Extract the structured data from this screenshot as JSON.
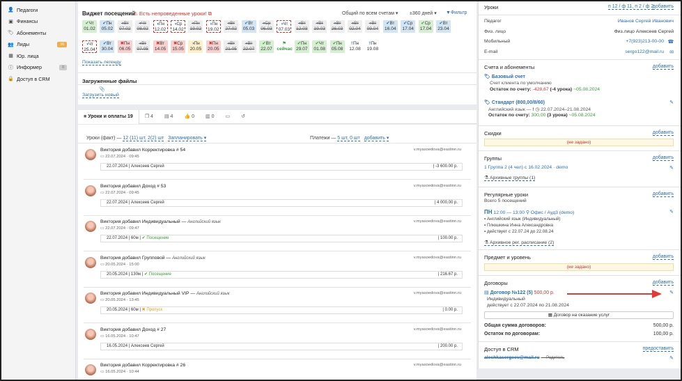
{
  "sidebar": {
    "items": [
      {
        "label": "Педагоги",
        "icon": "user-icon"
      },
      {
        "label": "Финансы",
        "icon": "money-icon"
      },
      {
        "label": "Абонементы",
        "icon": "tag-icon"
      },
      {
        "label": "Лиды",
        "icon": "users-icon",
        "badge": "16"
      },
      {
        "label": "Юр. лица",
        "icon": "building-icon"
      },
      {
        "label": "Информер",
        "icon": "bell-icon",
        "badge": "0"
      },
      {
        "label": "Доступ в CRM",
        "icon": "lock-icon"
      }
    ]
  },
  "widget": {
    "title": "Виджет посещений",
    "warning": "Есть непроведенные уроки!",
    "account_filter": "Общий по всем счетам",
    "period": "±360 дней",
    "filter": "Фильтр",
    "legend_link": "Показать легенду",
    "row1": [
      {
        "w": "Чт",
        "d": "01.02",
        "c": "green"
      },
      {
        "w": "Пн",
        "d": "05.02",
        "c": "blue"
      },
      {
        "w": "Вт",
        "d": "07.02",
        "c": "grey",
        "s": true
      },
      {
        "w": "Чт",
        "d": "08.02",
        "c": "grey",
        "s": true
      },
      {
        "w": "Пн",
        "d": "12.02",
        "c": "white",
        "x": true
      },
      {
        "w": "Ср",
        "d": "14.02",
        "c": "white",
        "x": true
      },
      {
        "w": "Пн",
        "d": "19.02",
        "c": "grey",
        "s": true
      },
      {
        "w": "Пн",
        "d": "19.02",
        "c": "white",
        "x": true
      },
      {
        "w": "Вт",
        "d": "27.02",
        "c": "grey",
        "s": true
      },
      {
        "w": "Вт",
        "d": "05.03",
        "c": "blue"
      },
      {
        "w": "Ср",
        "d": "06.03",
        "c": "grey",
        "s": true
      },
      {
        "w": "Чт",
        "d": "07.03",
        "c": "white",
        "x": true
      },
      {
        "w": "Вт",
        "d": "12.03",
        "c": "grey",
        "s": true
      },
      {
        "w": "Вт",
        "d": "19.03",
        "c": "grey",
        "s": true
      },
      {
        "w": "Вт",
        "d": "26.03",
        "c": "grey",
        "s": true
      },
      {
        "w": "Вт",
        "d": "02.04",
        "c": "grey",
        "s": true
      },
      {
        "w": "Вт",
        "d": "09.04",
        "c": "grey",
        "s": true
      },
      {
        "w": "Вт",
        "d": "16.04",
        "c": "blue"
      },
      {
        "w": "Ср",
        "d": "17.04",
        "c": "blue"
      },
      {
        "w": "Ср",
        "d": "17.04",
        "c": "green"
      },
      {
        "w": "Вт",
        "d": "23.04",
        "c": "blue"
      }
    ],
    "row2": [
      {
        "w": "Чт",
        "d": "25.04",
        "c": "white",
        "x": true
      },
      {
        "w": "Вт",
        "d": "30.04",
        "c": "blue"
      },
      {
        "w": "Пн",
        "d": "06.05",
        "c": "red"
      },
      {
        "w": "Вт",
        "d": "07.05",
        "c": "grey",
        "s": true
      },
      {
        "w": "Вт",
        "d": "14.05",
        "c": "red"
      },
      {
        "w": "Ср",
        "d": "15.05",
        "c": "red"
      },
      {
        "w": "Пн",
        "d": "20.05",
        "c": "yellow"
      },
      {
        "w": "Пн",
        "d": "20.05",
        "c": "red"
      },
      {
        "w": "Вт",
        "d": "21.05",
        "c": "grey",
        "s": true
      },
      {
        "w": "Вт",
        "d": "22.07",
        "c": "grey",
        "s": true
      },
      {
        "w": "Вт",
        "d": "22.07",
        "c": "green"
      },
      {
        "w": "",
        "d": "сейчас",
        "c": "now"
      },
      {
        "w": "Пн",
        "d": "29.07",
        "c": "green"
      },
      {
        "w": "Чт",
        "d": "01.08",
        "c": "green"
      },
      {
        "w": "Пн",
        "d": "05.08",
        "c": "green"
      },
      {
        "w": "Пн",
        "d": "12.08",
        "c": "plain"
      },
      {
        "w": "Пн",
        "d": "19.08",
        "c": "plain"
      }
    ]
  },
  "files": {
    "title": "Загруженные файлы",
    "upload": "Загрузить новый"
  },
  "tabs": [
    {
      "label": "Уроки и оплаты 19",
      "icon": "list-icon"
    },
    {
      "label": "4",
      "icon": "note-icon"
    },
    {
      "label": "4",
      "icon": "file-icon"
    },
    {
      "label": "0",
      "icon": "thumb-icon"
    },
    {
      "label": "0",
      "icon": "doc-icon"
    },
    {
      "label": "",
      "icon": "card-icon"
    },
    {
      "label": "",
      "icon": "history-icon"
    }
  ],
  "lessons_header": {
    "lessons_label": "Уроки (факт) —",
    "lessons_count": "12 (11) шт, 2(2) шт",
    "plan": "Запланировать",
    "payments_label": "Платежи —",
    "payments_count": "5 шт, 0 шт",
    "add": "добавить"
  },
  "entries": [
    {
      "author": "Виктория",
      "action": "добавил Корректировка # 54",
      "sub": "",
      "meta": "22.07.2024 · 09:45",
      "email": "v.myasoedova@eastinn.ru",
      "bar": "22.07.2024 | Алексеев Сергей",
      "status": "",
      "status_class": "",
      "amount": "| -3 600.00 р."
    },
    {
      "author": "Виктория",
      "action": "добавил Доход # 53",
      "sub": "",
      "meta": "22.07.2024 · 09:45",
      "email": "v.myasoedova@eastinn.ru",
      "bar": "22.07.2024 | Алексеев Сергей",
      "status": "",
      "status_class": "",
      "amount": "| 4 000,00 р."
    },
    {
      "author": "Виктория",
      "action": "добавил Индивидуальный —",
      "sub": "Английский язык",
      "meta": "22.07.2024 · 09:47",
      "email": "v.myasoedova@eastinn.ru",
      "bar": "22.07.2024 | 60м |",
      "status": "✔ Посещение",
      "status_class": "green",
      "amount": "| 100.00 р."
    },
    {
      "author": "Виктория",
      "action": "добавил Групповой —",
      "sub": "Английский язык",
      "meta": "20.05.2024 · 15:00",
      "email": "v.myasoedova@eastinn.ru",
      "bar": "20.05.2024 | 130м |",
      "status": "✔ Посещение",
      "status_class": "green",
      "amount": "| 216.67 р."
    },
    {
      "author": "Виктория",
      "action": "добавил Индивидуальный VIP —",
      "sub": "Английский язык",
      "meta": "20.05.2024 · 13:45",
      "email": "v.myasoedova@eastinn.ru",
      "bar": "20.05.2024 | 60м |",
      "status": "✖ Пропуск",
      "status_class": "orange",
      "amount": "| 0.00 р."
    },
    {
      "author": "Виктория",
      "action": "добавил Доход # 27",
      "sub": "",
      "meta": "16.05.2024 · 10:47",
      "email": "v.myasoedova@eastinn.ru",
      "bar": "16.05.2024 | Алексеев Сергей",
      "status": "",
      "status_class": "",
      "amount": "| 200.00 р."
    },
    {
      "author": "Виктория",
      "action": "добавил Корректировка # 26",
      "sub": "",
      "meta": "16.05.2024 · 10:44",
      "email": "v.myasoedova@eastinn.ru",
      "bar": "",
      "status": "",
      "status_class": "",
      "amount": ""
    }
  ],
  "right": {
    "lessons": {
      "label": "Уроки",
      "value": "п 12 / ф 11, п 2 / ф 2",
      "add": "добавить"
    },
    "info": [
      {
        "k": "Педагог",
        "v": "Иванов Сергей Иванович",
        "link": true
      },
      {
        "k": "Физ. лицо",
        "v": "Физ.лицо Алексеев Сергей",
        "link": false
      },
      {
        "k": "Мобильный",
        "v": "+7(923)213-00-00",
        "link": true
      },
      {
        "k": "E-mail",
        "v": "sergo122@mail.ru",
        "link": true
      }
    ],
    "accounts": {
      "title": "Счета и абонементы",
      "add": "добавить",
      "base": {
        "name": "Базовый счет",
        "desc": "Счет клиента по умолчанию",
        "rest_label": "Остаток по счету:",
        "rest": "-428,67",
        "lessons": "(-4 урока)",
        "date": "~05.08.2024"
      },
      "std": {
        "name": "Стандарт (800,00/8/60)",
        "desc": "Английский язык — ",
        "period": "22.07.2024–21.08.2024",
        "rest_label": "Остаток по счету:",
        "rest": "300,00",
        "lessons": "(3 урока)",
        "date": "~05.08.2024"
      }
    },
    "discounts": {
      "title": "Скидки",
      "add": "добавить",
      "notset": "(не задано)"
    },
    "groups": {
      "title": "Группы",
      "add": "добавить",
      "line": "1 Группа 2 (4 чел) с 16.02.2024 · demo",
      "archive": "Архивные группы (1)"
    },
    "regular": {
      "title": "Регулярные уроки",
      "add": "добавить",
      "total": "Всего 5 посещений",
      "day": "ПН",
      "time": "12:00 — 13:00",
      "place": "Офис / Ауд3 (demo)",
      "subject": "Английский язык (Индивидуальный)",
      "teacher": "Плюшкина Инна Александровна",
      "valid": "действует с 22.07.24 до 22.08.24",
      "archive": "Архивное рег. расписание (2)"
    },
    "subject": {
      "title": "Предмет и уровень",
      "add": "добавить",
      "notset": "(не задано)"
    },
    "contracts": {
      "title": "Договоры",
      "add": "добавить",
      "name": "Договор №122 (5)",
      "amount": "500,00 р.",
      "type": "Индивидуальный",
      "valid": "действует с 22.07.2024 по 21.08.2024",
      "btn": "Договор на оказание услуг",
      "total_label": "Общая сумма договоров:",
      "total": "500,00 р.",
      "rest_label": "Остаток по договорам:",
      "rest": "100,00 р."
    },
    "crm": {
      "title": "Доступ в CRM",
      "add": "предоставить",
      "email": "aleshkasergeev@mail.ru",
      "role": "Родитель"
    }
  },
  "colors": {
    "accent": "#2a6fb6",
    "danger": "#d9302b",
    "success": "#3c9a3c",
    "arrow": "#e53935"
  }
}
